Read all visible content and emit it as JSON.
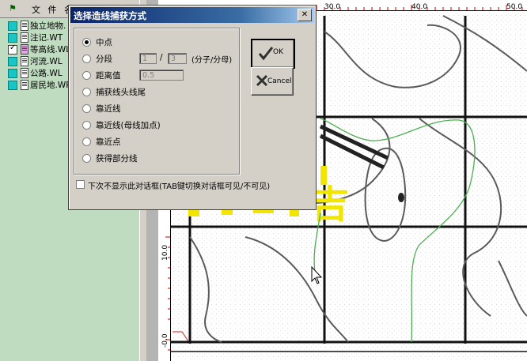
{
  "layer_panel": {
    "header_column": "文 件 名",
    "items": [
      {
        "label": "独立地物.",
        "checked": false
      },
      {
        "label": "注记.WT",
        "checked": false
      },
      {
        "label": "等高线.WL",
        "checked": true
      },
      {
        "label": "河流.WL",
        "checked": false
      },
      {
        "label": "公路.WL",
        "checked": false
      },
      {
        "label": "居民地.WP",
        "checked": false
      }
    ]
  },
  "ruler": {
    "top_ticks": [
      "30.0",
      "40.0",
      "50.0"
    ],
    "left_ticks": [
      "10.0",
      "-0.0"
    ]
  },
  "map_text": {
    "yellow_glyphs": "吉"
  },
  "dialog": {
    "title": "选择造线捕获方式",
    "close_symbol": "✕",
    "options": [
      {
        "label": "中点",
        "selected": true
      },
      {
        "label": "分段",
        "selected": false
      },
      {
        "label": "距离值",
        "selected": false
      },
      {
        "label": "捕获线头线尾",
        "selected": false
      },
      {
        "label": "靠近线",
        "selected": false
      },
      {
        "label": "靠近线(母线加点)",
        "selected": false
      },
      {
        "label": "靠近点",
        "selected": false
      },
      {
        "label": "获得部分线",
        "selected": false
      }
    ],
    "segment": {
      "numerator": "1",
      "separator": "/",
      "denominator": "3",
      "hint": "(分子/分母)"
    },
    "distance_value": "0.5",
    "ok_label": "OK",
    "cancel_label": "Cancel",
    "dont_show_label": "下次不显示此对话框(TAB键切换对话框可见/不可见)",
    "dont_show_checked": false
  },
  "colors": {
    "dialog_face": "#d4d0c8",
    "title_gradient_start": "#0a246a",
    "layer_panel_bg": "#c0dcc0",
    "contour_green": "#4caf50",
    "yellow_text": "#f2e600"
  }
}
